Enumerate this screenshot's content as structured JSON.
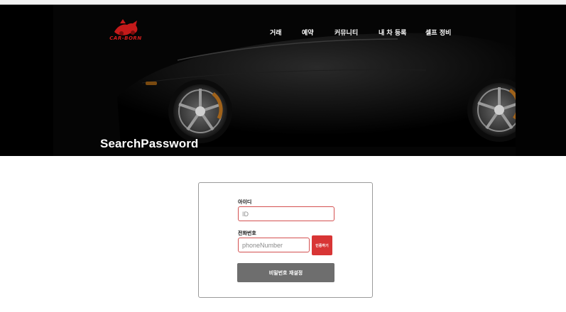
{
  "brand": {
    "name": "CAR-BORN",
    "color": "#d31d1d"
  },
  "nav": {
    "items": [
      {
        "label": "거래"
      },
      {
        "label": "예약"
      },
      {
        "label": "커뮤니티"
      },
      {
        "label": "내 차 등록"
      },
      {
        "label": "셀프 정비"
      }
    ]
  },
  "hero": {
    "title": "SearchPassword"
  },
  "form": {
    "id_label": "아이디",
    "id_placeholder": "ID",
    "phone_label": "전화번호",
    "phone_placeholder": "phoneNumber",
    "verify_button": "인증하기",
    "submit_button": "비밀번호 재설정"
  },
  "colors": {
    "accent": "#d83535",
    "submit": "#6e6e6e",
    "input_border": "#d45050"
  }
}
